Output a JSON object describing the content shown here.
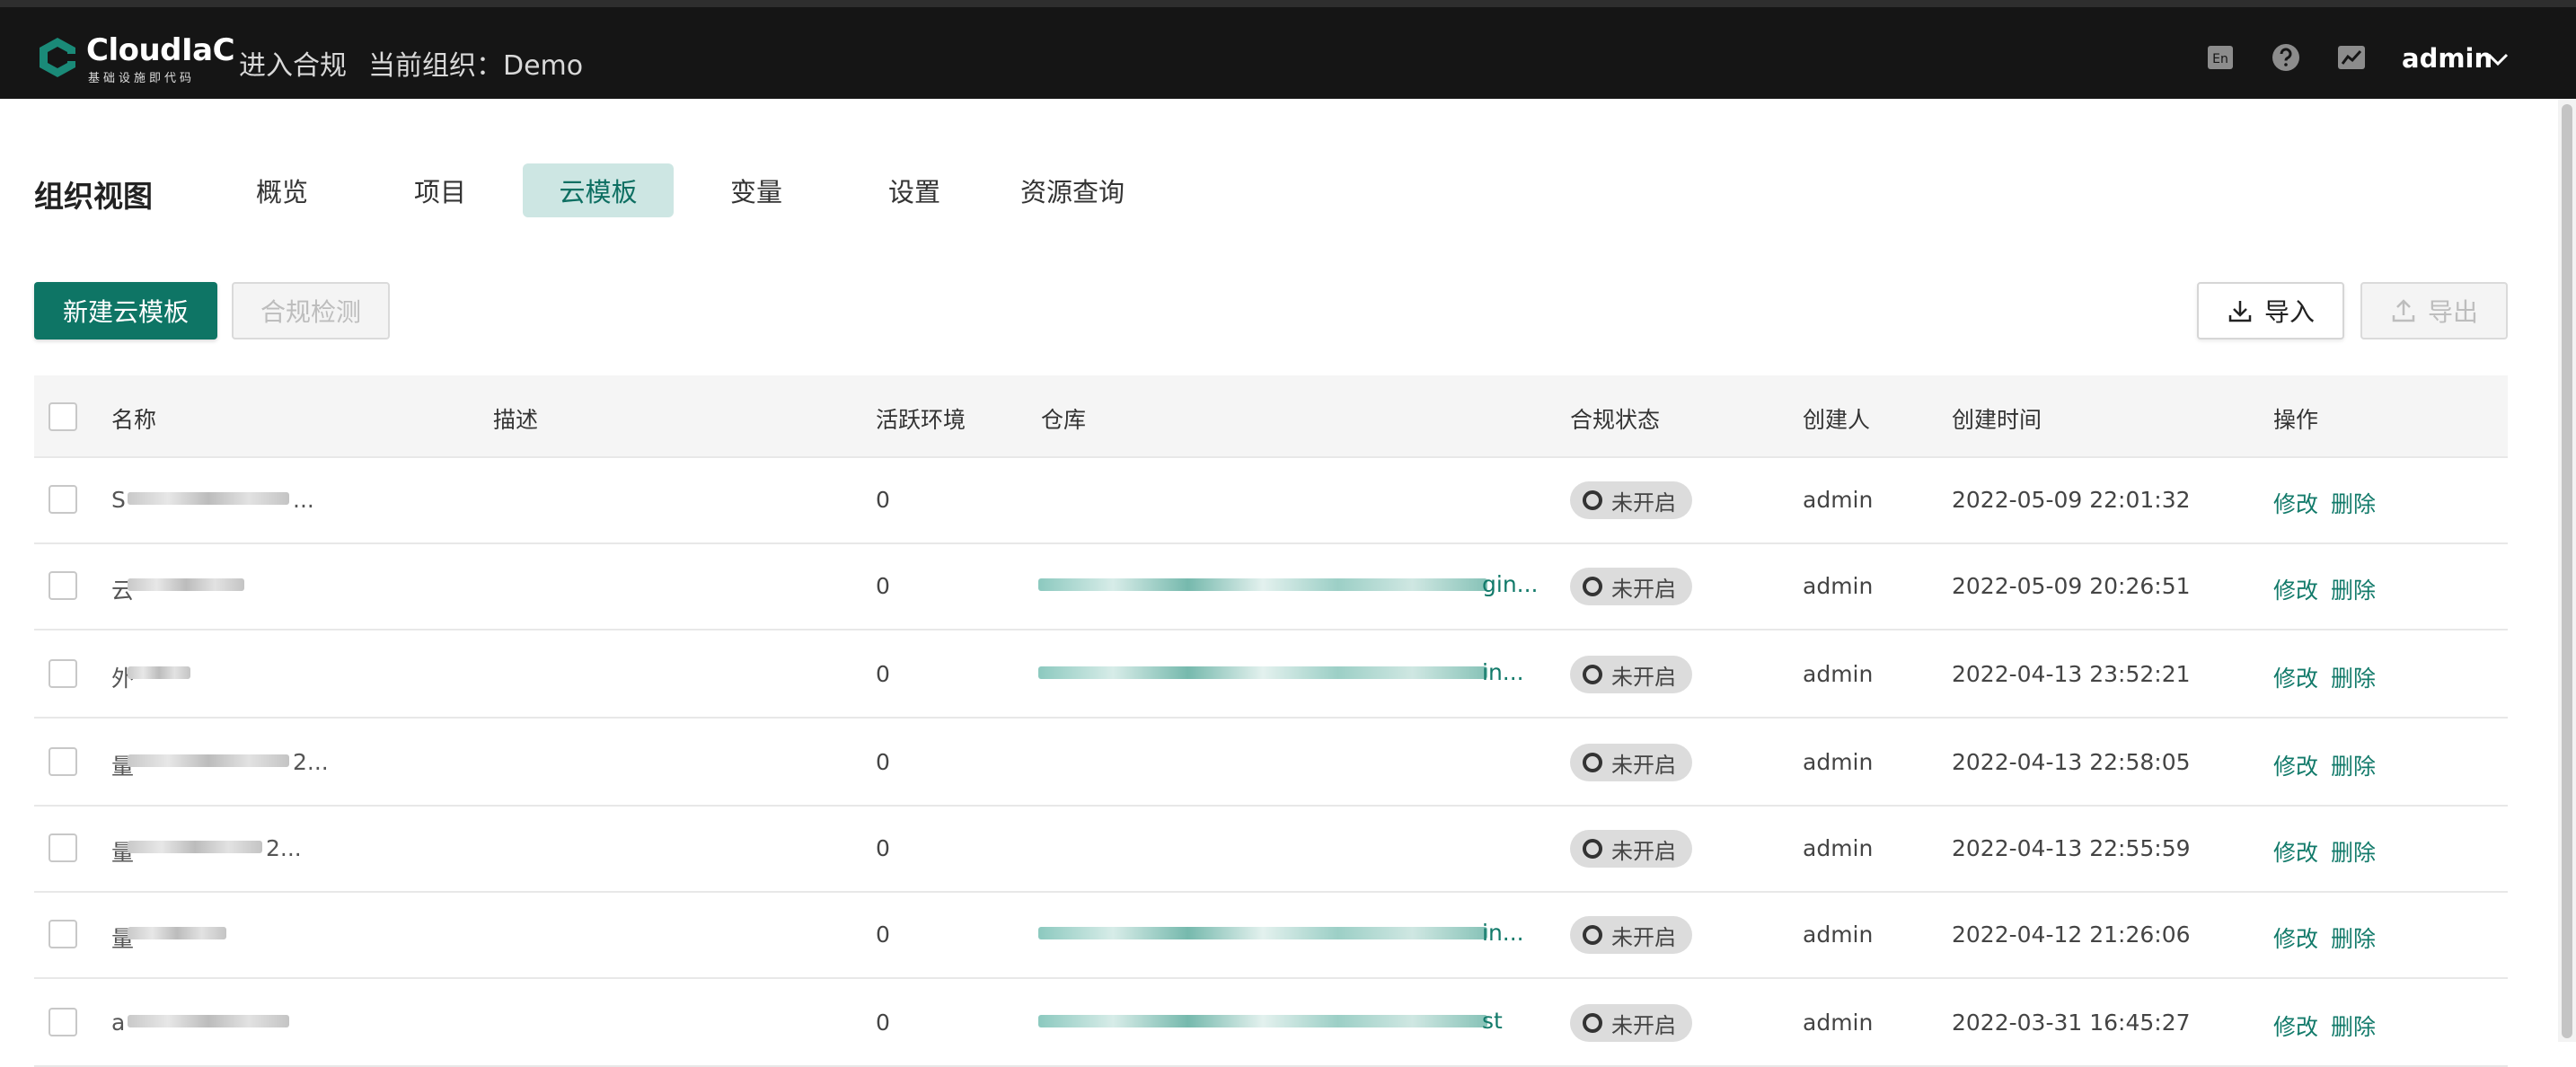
{
  "topbar": {
    "logo_title": "CloudIaC",
    "logo_subtitle": "基础设施即代码",
    "enter_compliance": "进入合规",
    "current_org": "当前组织：Demo",
    "lang_icon": "En",
    "user": "admin"
  },
  "nav": {
    "page_title": "组织视图",
    "tabs": [
      "概览",
      "项目",
      "云模板",
      "变量",
      "设置",
      "资源查询"
    ],
    "active_tab": "云模板"
  },
  "actions": {
    "create": "新建云模板",
    "compliance_check": "合规检测",
    "import": "导入",
    "export": "导出"
  },
  "table": {
    "columns": {
      "name": "名称",
      "description": "描述",
      "active_env": "活跃环境",
      "repo": "仓库",
      "compliance_status": "合规状态",
      "creator": "创建人",
      "created_at": "创建时间",
      "operation": "操作"
    },
    "rows": [
      {
        "name_visible": "S",
        "name_tail": "...",
        "active_env": "0",
        "repo_tail": "",
        "status": "未开启",
        "creator": "admin",
        "created_at": "2022-05-09 22:01:32",
        "edit": "修改",
        "delete": "删除"
      },
      {
        "name_visible": "云",
        "name_tail": "",
        "active_env": "0",
        "repo_tail": "gin...",
        "status": "未开启",
        "creator": "admin",
        "created_at": "2022-05-09 20:26:51",
        "edit": "修改",
        "delete": "删除"
      },
      {
        "name_visible": "外",
        "name_tail": "",
        "active_env": "0",
        "repo_tail": "in...",
        "status": "未开启",
        "creator": "admin",
        "created_at": "2022-04-13 23:52:21",
        "edit": "修改",
        "delete": "删除"
      },
      {
        "name_visible": "量",
        "name_tail": "2...",
        "active_env": "0",
        "repo_tail": "",
        "status": "未开启",
        "creator": "admin",
        "created_at": "2022-04-13 22:58:05",
        "edit": "修改",
        "delete": "删除"
      },
      {
        "name_visible": "量",
        "name_tail": "2...",
        "active_env": "0",
        "repo_tail": "",
        "status": "未开启",
        "creator": "admin",
        "created_at": "2022-04-13 22:55:59",
        "edit": "修改",
        "delete": "删除"
      },
      {
        "name_visible": "量",
        "name_tail": "",
        "active_env": "0",
        "repo_tail": "in...",
        "status": "未开启",
        "creator": "admin",
        "created_at": "2022-04-12 21:26:06",
        "edit": "修改",
        "delete": "删除"
      },
      {
        "name_visible": "a",
        "name_tail": "",
        "active_env": "0",
        "repo_tail": "st",
        "status": "未开启",
        "creator": "admin",
        "created_at": "2022-03-31 16:45:27",
        "edit": "修改",
        "delete": "删除"
      }
    ]
  },
  "colors": {
    "primary": "#0e7565",
    "tab_active_bg": "#cde6e3",
    "link": "#127a6a",
    "topbar_bg": "#151515"
  }
}
